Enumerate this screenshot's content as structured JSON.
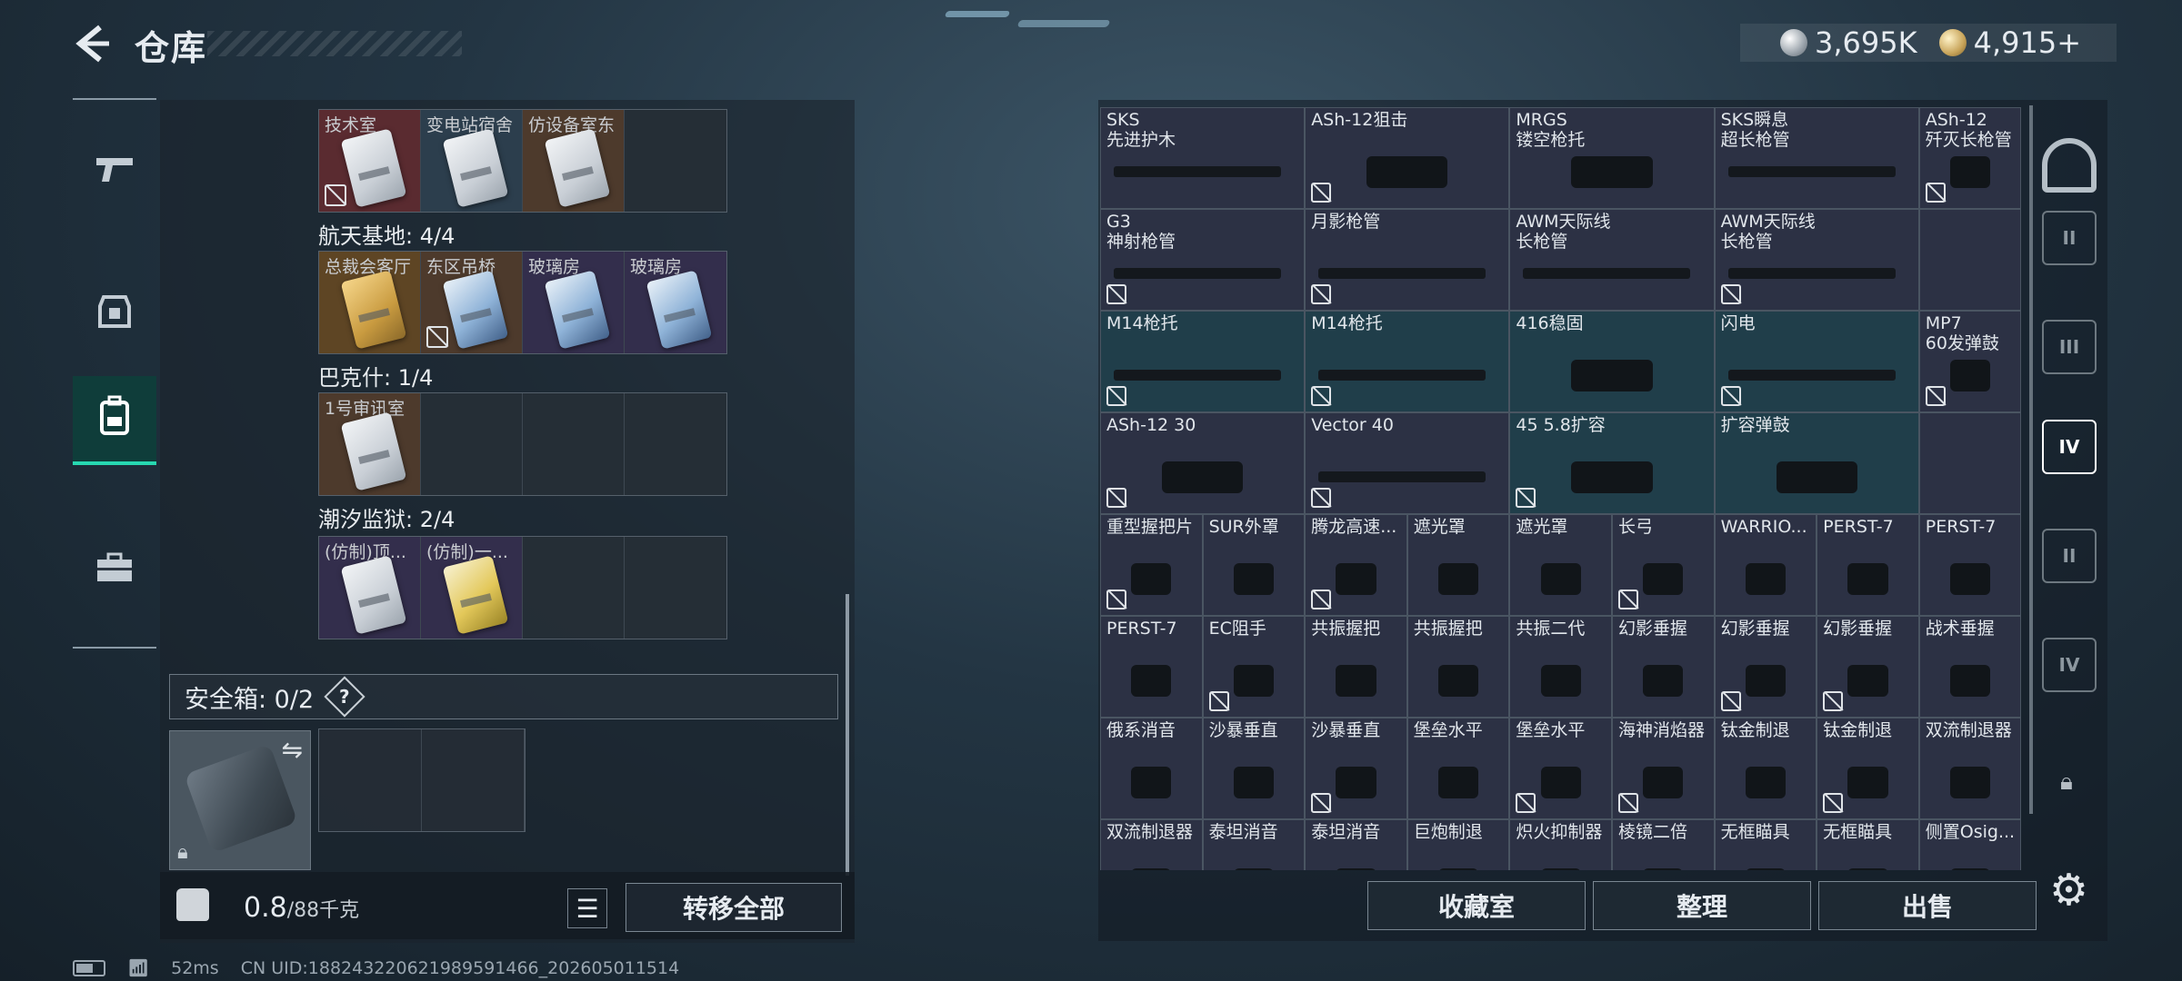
{
  "header": {
    "title": "仓库",
    "currency_silver": "3,695K",
    "currency_gold": "4,915+"
  },
  "left_nav": {
    "items": [
      "gun-icon",
      "armor-icon",
      "backpack-icon",
      "toolbox-icon"
    ],
    "active_index": 2
  },
  "stash": {
    "row0": {
      "slots": [
        {
          "label": "技术室",
          "tone": "red",
          "card": "white",
          "lock": true
        },
        {
          "label": "变电站宿舍",
          "tone": "blue",
          "card": "white",
          "lock": false
        },
        {
          "label": "仿设备室东",
          "tone": "brown",
          "card": "white",
          "lock": false
        },
        {
          "label": "",
          "tone": "empty",
          "card": "",
          "lock": false
        }
      ]
    },
    "sections": [
      {
        "label": "航天基地: 4/4",
        "slots": [
          {
            "label": "总裁会客厅",
            "tone": "gold",
            "card": "gold",
            "lock": false
          },
          {
            "label": "东区吊桥",
            "tone": "brown",
            "card": "blue",
            "lock": true
          },
          {
            "label": "玻璃房",
            "tone": "purple",
            "card": "blue",
            "lock": false
          },
          {
            "label": "玻璃房",
            "tone": "purple",
            "card": "blue",
            "lock": false
          }
        ]
      },
      {
        "label": "巴克什: 1/4",
        "slots": [
          {
            "label": "1号审讯室",
            "tone": "brown",
            "card": "white",
            "lock": false
          },
          {
            "label": "",
            "tone": "empty",
            "card": "",
            "lock": false
          },
          {
            "label": "",
            "tone": "empty",
            "card": "",
            "lock": false
          },
          {
            "label": "",
            "tone": "empty",
            "card": "",
            "lock": false
          }
        ]
      },
      {
        "label": "潮汐监狱: 2/4",
        "slots": [
          {
            "label": "(仿制)顶...",
            "tone": "purple",
            "card": "white",
            "lock": false
          },
          {
            "label": "(仿制)一...",
            "tone": "purple",
            "card": "yellow",
            "lock": false
          },
          {
            "label": "",
            "tone": "empty",
            "card": "",
            "lock": false
          },
          {
            "label": "",
            "tone": "empty",
            "card": "",
            "lock": false
          }
        ]
      }
    ],
    "safe_label": "安全箱:  0/2",
    "help": "?",
    "weight_value": "0.8",
    "weight_max": "/88千克",
    "transfer_label": "转移全部"
  },
  "inventory": {
    "cells": [
      {
        "name": "SKS\n先进护木",
        "span": 2,
        "kind": "gun",
        "tone": "",
        "lock": false
      },
      {
        "name": "ASh-12狙击",
        "span": 2,
        "kind": "part",
        "tone": "",
        "lock": true
      },
      {
        "name": "MRGS\n镂空枪托",
        "span": 2,
        "kind": "part",
        "tone": "",
        "lock": false
      },
      {
        "name": "SKS瞬息\n超长枪管",
        "span": 2,
        "kind": "gun",
        "tone": "",
        "lock": false
      },
      {
        "name": "ASh-12\n歼灭长枪管",
        "span": 1,
        "kind": "part",
        "tone": "",
        "lock": true
      },
      {
        "name": "G3\n神射枪管",
        "span": 2,
        "kind": "gun",
        "tone": "",
        "lock": true
      },
      {
        "name": "月影枪管",
        "span": 2,
        "kind": "gun",
        "tone": "",
        "lock": true
      },
      {
        "name": "AWM天际线\n长枪管",
        "span": 2,
        "kind": "gun",
        "tone": "",
        "lock": false
      },
      {
        "name": "AWM天际线\n长枪管",
        "span": 2,
        "kind": "gun",
        "tone": "",
        "lock": true
      },
      {
        "name": "",
        "span": 1,
        "kind": "",
        "tone": "",
        "lock": false
      },
      {
        "name": "M14枪托",
        "span": 2,
        "kind": "gun",
        "tone": "teal",
        "lock": true
      },
      {
        "name": "M14枪托",
        "span": 2,
        "kind": "gun",
        "tone": "teal",
        "lock": true
      },
      {
        "name": "416稳固",
        "span": 2,
        "kind": "part",
        "tone": "teal",
        "lock": false
      },
      {
        "name": "闪电",
        "span": 2,
        "kind": "gun",
        "tone": "teal",
        "lock": true
      },
      {
        "name": "MP7\n60发弹鼓",
        "span": 1,
        "kind": "part",
        "tone": "",
        "lock": true
      },
      {
        "name": "ASh-12 30",
        "span": 2,
        "kind": "part",
        "tone": "",
        "lock": true
      },
      {
        "name": "Vector 40",
        "span": 2,
        "kind": "gun",
        "tone": "",
        "lock": true
      },
      {
        "name": "45 5.8扩容",
        "span": 2,
        "kind": "part",
        "tone": "teal",
        "lock": true
      },
      {
        "name": "扩容弹鼓",
        "span": 2,
        "kind": "part",
        "tone": "teal",
        "lock": false
      },
      {
        "name": "",
        "span": 1,
        "kind": "",
        "tone": "",
        "lock": false
      },
      {
        "name": "重型握把片",
        "span": 1,
        "kind": "part",
        "tone": "",
        "lock": true
      },
      {
        "name": "SUR外罩",
        "span": 1,
        "kind": "part",
        "tone": "",
        "lock": false
      },
      {
        "name": "腾龙高速...",
        "span": 1,
        "kind": "part",
        "tone": "",
        "lock": true
      },
      {
        "name": "遮光罩",
        "span": 1,
        "kind": "part",
        "tone": "",
        "lock": false
      },
      {
        "name": "遮光罩",
        "span": 1,
        "kind": "part",
        "tone": "",
        "lock": false
      },
      {
        "name": "长弓",
        "span": 1,
        "kind": "part",
        "tone": "",
        "lock": true
      },
      {
        "name": "WARRIO...",
        "span": 1,
        "kind": "part",
        "tone": "",
        "lock": false
      },
      {
        "name": "PERST-7",
        "span": 1,
        "kind": "part",
        "tone": "",
        "lock": false
      },
      {
        "name": "PERST-7",
        "span": 1,
        "kind": "part",
        "tone": "",
        "lock": false
      },
      {
        "name": "PERST-7",
        "span": 1,
        "kind": "part",
        "tone": "",
        "lock": false
      },
      {
        "name": "EC阻手",
        "span": 1,
        "kind": "part",
        "tone": "",
        "lock": true
      },
      {
        "name": "共振握把",
        "span": 1,
        "kind": "part",
        "tone": "",
        "lock": false
      },
      {
        "name": "共振握把",
        "span": 1,
        "kind": "part",
        "tone": "",
        "lock": false
      },
      {
        "name": "共振二代",
        "span": 1,
        "kind": "part",
        "tone": "",
        "lock": false
      },
      {
        "name": "幻影垂握",
        "span": 1,
        "kind": "part",
        "tone": "",
        "lock": false
      },
      {
        "name": "幻影垂握",
        "span": 1,
        "kind": "part",
        "tone": "",
        "lock": true
      },
      {
        "name": "幻影垂握",
        "span": 1,
        "kind": "part",
        "tone": "",
        "lock": true
      },
      {
        "name": "战术垂握",
        "span": 1,
        "kind": "part",
        "tone": "",
        "lock": false
      },
      {
        "name": "俄系消音",
        "span": 1,
        "kind": "part",
        "tone": "",
        "lock": false
      },
      {
        "name": "沙暴垂直",
        "span": 1,
        "kind": "part",
        "tone": "",
        "lock": false
      },
      {
        "name": "沙暴垂直",
        "span": 1,
        "kind": "part",
        "tone": "",
        "lock": true
      },
      {
        "name": "堡垒水平",
        "span": 1,
        "kind": "part",
        "tone": "",
        "lock": false
      },
      {
        "name": "堡垒水平",
        "span": 1,
        "kind": "part",
        "tone": "",
        "lock": true
      },
      {
        "name": "海神消焰器",
        "span": 1,
        "kind": "part",
        "tone": "",
        "lock": true
      },
      {
        "name": "钛金制退",
        "span": 1,
        "kind": "part",
        "tone": "",
        "lock": false
      },
      {
        "name": "钛金制退",
        "span": 1,
        "kind": "part",
        "tone": "",
        "lock": true
      },
      {
        "name": "双流制退器",
        "span": 1,
        "kind": "part",
        "tone": "",
        "lock": false
      },
      {
        "name": "双流制退器",
        "span": 1,
        "kind": "part",
        "tone": "",
        "lock": false
      },
      {
        "name": "泰坦消音",
        "span": 1,
        "kind": "part",
        "tone": "",
        "lock": false
      },
      {
        "name": "泰坦消音",
        "span": 1,
        "kind": "part",
        "tone": "",
        "lock": false
      },
      {
        "name": "巨炮制退",
        "span": 1,
        "kind": "part",
        "tone": "",
        "lock": false
      },
      {
        "name": "炽火抑制器",
        "span": 1,
        "kind": "part",
        "tone": "",
        "lock": false
      },
      {
        "name": "棱镜二倍",
        "span": 1,
        "kind": "part",
        "tone": "",
        "lock": false
      },
      {
        "name": "无框瞄具",
        "span": 1,
        "kind": "part",
        "tone": "",
        "lock": false
      },
      {
        "name": "无框瞄具",
        "span": 1,
        "kind": "part",
        "tone": "",
        "lock": false
      },
      {
        "name": "侧置Osig...",
        "span": 1,
        "kind": "part",
        "tone": "",
        "lock": false
      }
    ],
    "actions": [
      "收藏室",
      "整理",
      "出售"
    ]
  },
  "tier_nav": {
    "items": [
      "",
      "II",
      "III",
      "IV",
      "II",
      "IV"
    ],
    "active_index": 3
  },
  "status": {
    "ping": "52ms",
    "uid": "CN UID:1882432206219895914​66_202605011514"
  },
  "colors": {
    "accent": "#27d8b1",
    "panel": "#2c3144",
    "teal_cell": "#203e4a"
  }
}
